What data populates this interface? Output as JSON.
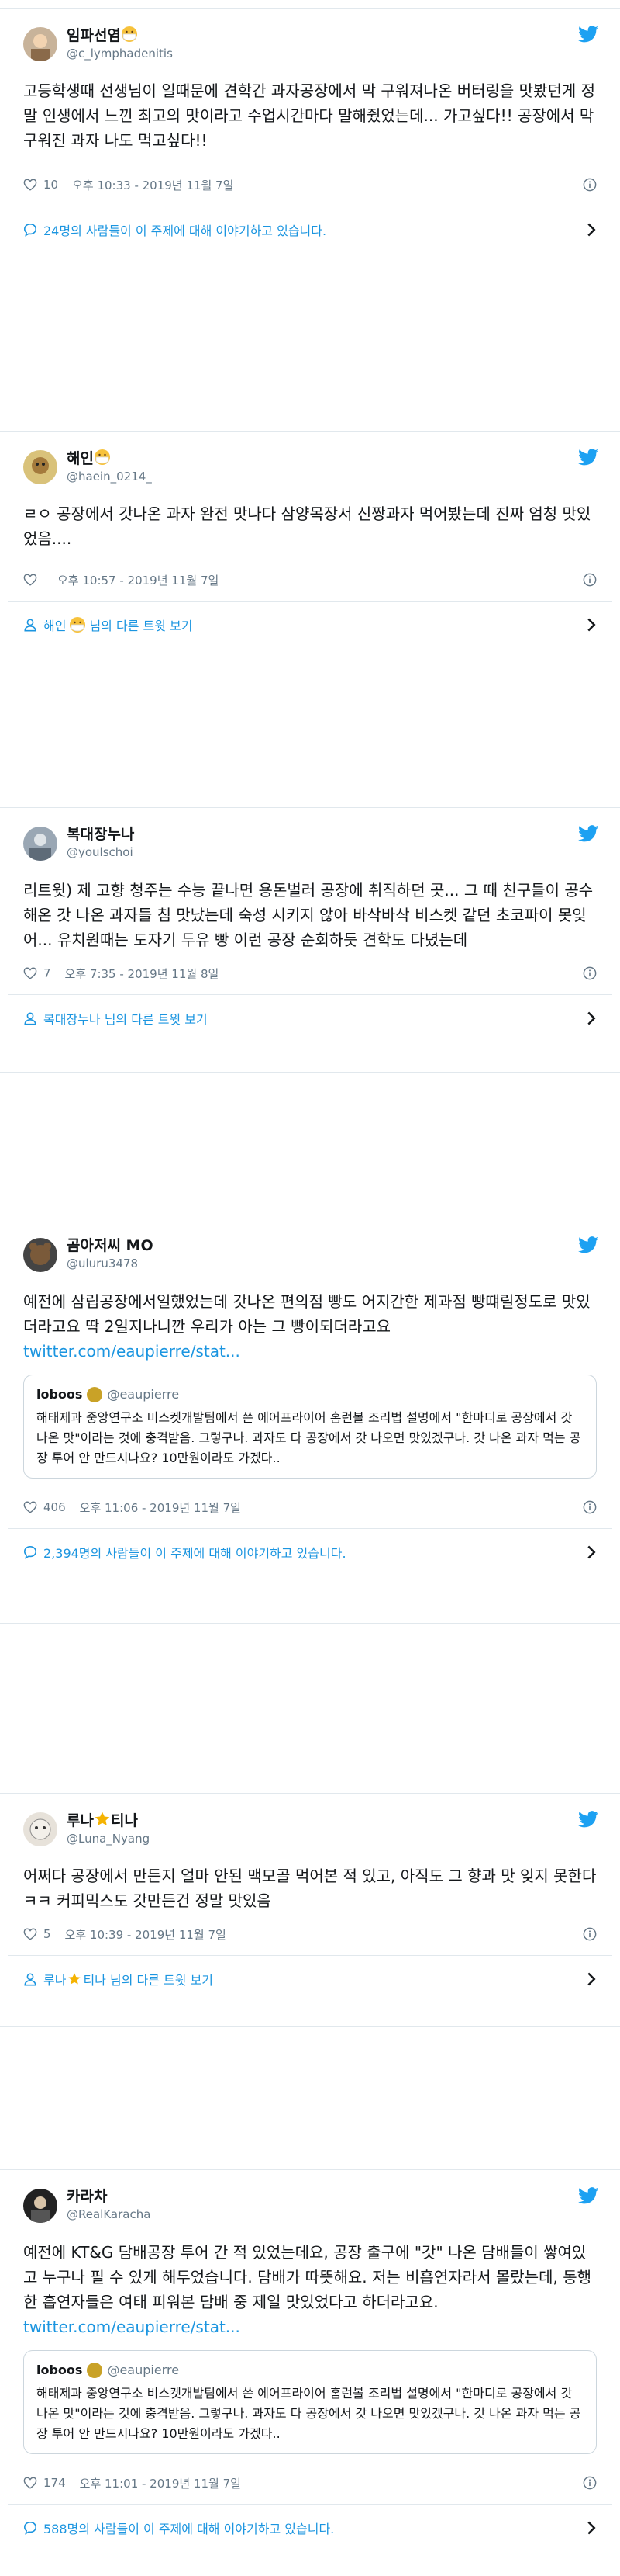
{
  "tweets": [
    {
      "display_name": "임파선염",
      "handle": "@c_lymphadenitis",
      "text": "고등학생때 선생님이 일때문에 견학간 과자공장에서 막 구워져나온 버터링을 맛봤던게 정말 인생에서 느낀 최고의 맛이라고 수업시간마다 말해줬었는데... 가고싶다!! 공장에서 막 구워진 과자 나도 먹고싶다!!",
      "likes": "10",
      "time": "오후 10:33 - 2019년 11월 7일",
      "footer": "24명의 사람들이 이 주제에 대해 이야기하고 있습니다."
    },
    {
      "display_name": "해인",
      "handle": "@haein_0214_",
      "text": "ㄹㅇ 공장에서 갓나온 과자 완전 맛나다 삼양목장서 신짱과자 먹어봤는데 진짜 엄청 맛있었음....",
      "likes": "",
      "time": "오후 10:57 - 2019년 11월 7일",
      "footer_name": "해인",
      "footer_suffix": "님의 다른 트윗 보기"
    },
    {
      "display_name": "복대장누나",
      "handle": "@youlschoi",
      "text": "리트윗) 제 고향 청주는 수능 끝나면 용돈벌러 공장에 취직하던 곳... 그 때 친구들이 공수해온 갓 나온 과자들 침 맛났는데 숙성 시키지 않아 바삭바삭 비스켓 같던 초코파이 못잊어... 유치원때는 도자기 두유 빵 이런 공장 순회하듯 견학도 다녔는데",
      "likes": "7",
      "time": "오후 7:35 - 2019년 11월 8일",
      "footer_name": "복대장누나",
      "footer_suffix": "님의 다른 트윗 보기"
    },
    {
      "display_name": "곰아저씨 MO",
      "handle": "@uluru3478",
      "text": "예전에 삼립공장에서일했었는데 갓나온 편의점 빵도 어지간한 제과점 빵떄릴정도로 맛있더라고요  딱 2일지나니깐 우리가 아는 그 빵이되더라고요",
      "link": "twitter.com/eaupierre/stat...",
      "quote": {
        "name": "loboos",
        "handle": "@eaupierre",
        "text": "해태제과 중앙연구소 비스켓개발팀에서 쓴 에어프라이어 홈런볼 조리법 설명에서 \"한마디로 공장에서 갓 나온 맛\"이라는 것에 충격받음. 그렇구나. 과자도 다 공장에서 갓 나오면 맛있겠구나. 갓 나온 과자 먹는 공장 투어 안 만드시나요? 10만원이라도 가겠다.."
      },
      "likes": "406",
      "time": "오후 11:06 - 2019년 11월 7일",
      "footer": "2,394명의 사람들이 이 주제에 대해 이야기하고 있습니다."
    },
    {
      "display_name": "루나",
      "display_name_suffix": "티나",
      "handle": "@Luna_Nyang",
      "text": "어쩌다 공장에서 만든지 얼마 안된 맥모골 먹어본 적 있고, 아직도 그 향과 맛 잊지 못한다 ㅋㅋ 커피믹스도 갓만든건 정말 맛있음",
      "likes": "5",
      "time": "오후 10:39 - 2019년 11월 7일",
      "footer_name": "루나",
      "footer_name_suffix": "티나",
      "footer_suffix": "님의 다른 트윗 보기"
    },
    {
      "display_name": "카라차",
      "handle": "@RealKaracha",
      "text": "예전에 KT&G 담배공장 투어 간 적 있었는데요, 공장 출구에 \"갓\" 나온 담배들이 쌓여있고 누구나 필 수 있게 해두었습니다. 담배가 따뜻해요. 저는 비흡연자라서 몰랐는데, 동행한 흡연자들은 여태 피워본 담배 중 제일 맛있었다고 하더라고요.",
      "link": "twitter.com/eaupierre/stat...",
      "quote": {
        "name": "loboos",
        "handle": "@eaupierre",
        "text": "해태제과 중앙연구소 비스켓개발팀에서 쓴 에어프라이어 홈런볼 조리법 설명에서 \"한마디로 공장에서 갓 나온 맛\"이라는 것에 충격받음. 그렇구나. 과자도 다 공장에서 갓 나오면 맛있겠구나. 갓 나온 과자 먹는 공장 투어 안 만드시나요? 10만원이라도 가겠다.."
      },
      "likes": "174",
      "time": "오후 11:01 - 2019년 11월 7일",
      "footer": "588명의 사람들이 이 주제에 대해 이야기하고 있습니다."
    }
  ],
  "colors": {
    "accent": "#1b95e0",
    "muted": "#657786",
    "text": "#14171a",
    "border": "#e1e8ed"
  },
  "icons": [
    "twitter-bird-icon",
    "heart-icon",
    "info-icon",
    "chat-bubble-icon",
    "person-icon",
    "chevron-right-icon",
    "mask-emoji-icon",
    "star-emoji-icon"
  ]
}
